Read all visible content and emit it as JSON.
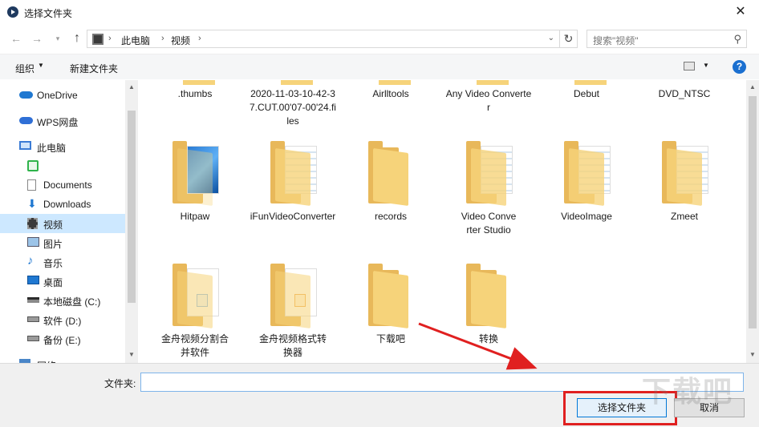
{
  "window": {
    "title": "选择文件夹",
    "close_glyph": "✕"
  },
  "nav": {
    "back": "←",
    "forward": "→",
    "recent": "▾",
    "up": "↑"
  },
  "address": {
    "sep": "›",
    "crumbs": [
      "此电脑",
      "视频"
    ],
    "dropdown": "⌄",
    "refresh": "↻"
  },
  "search": {
    "placeholder": "搜索\"视频\"",
    "icon": "search-icon"
  },
  "toolbar": {
    "organize": "组织",
    "caret": "▼",
    "new_folder": "新建文件夹",
    "help": "?"
  },
  "sidebar": {
    "items": [
      {
        "label": "OneDrive",
        "icon": "cloud-icon"
      },
      {
        "label": "WPS网盘",
        "icon": "wps-cloud-icon"
      },
      {
        "label": "此电脑",
        "icon": "computer-icon"
      },
      {
        "label": "",
        "icon": "phone-icon"
      },
      {
        "label": "Documents",
        "icon": "document-icon"
      },
      {
        "label": "Downloads",
        "icon": "download-icon"
      },
      {
        "label": "视频",
        "icon": "video-icon",
        "selected": true
      },
      {
        "label": "图片",
        "icon": "picture-icon"
      },
      {
        "label": "音乐",
        "icon": "music-icon"
      },
      {
        "label": "桌面",
        "icon": "desktop-icon"
      },
      {
        "label": "本地磁盘 (C:)",
        "icon": "drive-icon"
      },
      {
        "label": "软件 (D:)",
        "icon": "drive-icon"
      },
      {
        "label": "备份 (E:)",
        "icon": "drive-icon"
      },
      {
        "label": "网络",
        "icon": "network-icon"
      }
    ]
  },
  "files": {
    "row1": [
      ".thumbs",
      "2020-11-03-10-42-37.CUT.00'07-00'24.files",
      "Airlltools",
      "Any Video Converter",
      "Debut",
      "DVD_NTSC"
    ],
    "row2": [
      "Hitpaw",
      "iFunVideoConverter",
      "records",
      "Video Converter Studio",
      "VideoImage",
      "Zmeet"
    ],
    "row3": [
      "金舟视频分割合并软件",
      "金舟视频格式转换器",
      "下载吧",
      "转换"
    ]
  },
  "bottom": {
    "folder_label": "文件夹:",
    "folder_value": "",
    "select_button": "选择文件夹",
    "cancel_button": "取消"
  },
  "scroll": {
    "up": "▲",
    "down": "▼"
  },
  "watermark": "下载吧",
  "colors": {
    "selected_bg": "#cde8ff",
    "accent": "#0078d7",
    "highlight": "#e02020",
    "folder": "#f6d37a"
  }
}
